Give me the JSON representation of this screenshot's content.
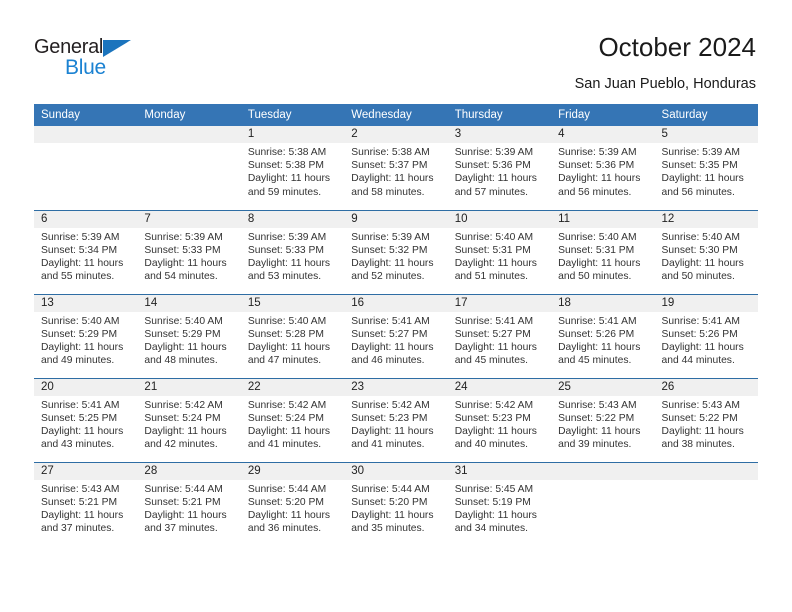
{
  "brand": {
    "name_dark": "General",
    "name_light": "Blue",
    "triangle_color": "#1b74bd",
    "blue_color": "#1b82d2"
  },
  "header": {
    "title": "October 2024",
    "location": "San Juan Pueblo, Honduras"
  },
  "theme": {
    "header_blue": "#3575b5",
    "separator_blue": "#2e6da4",
    "daynum_band": "#f0f0f0"
  },
  "weekdays": [
    "Sunday",
    "Monday",
    "Tuesday",
    "Wednesday",
    "Thursday",
    "Friday",
    "Saturday"
  ],
  "weeks": [
    [
      {
        "day": "",
        "empty": true
      },
      {
        "day": "",
        "empty": true
      },
      {
        "day": "1",
        "sunrise": "Sunrise: 5:38 AM",
        "sunset": "Sunset: 5:38 PM",
        "daylight1": "Daylight: 11 hours",
        "daylight2": "and 59 minutes."
      },
      {
        "day": "2",
        "sunrise": "Sunrise: 5:38 AM",
        "sunset": "Sunset: 5:37 PM",
        "daylight1": "Daylight: 11 hours",
        "daylight2": "and 58 minutes."
      },
      {
        "day": "3",
        "sunrise": "Sunrise: 5:39 AM",
        "sunset": "Sunset: 5:36 PM",
        "daylight1": "Daylight: 11 hours",
        "daylight2": "and 57 minutes."
      },
      {
        "day": "4",
        "sunrise": "Sunrise: 5:39 AM",
        "sunset": "Sunset: 5:36 PM",
        "daylight1": "Daylight: 11 hours",
        "daylight2": "and 56 minutes."
      },
      {
        "day": "5",
        "sunrise": "Sunrise: 5:39 AM",
        "sunset": "Sunset: 5:35 PM",
        "daylight1": "Daylight: 11 hours",
        "daylight2": "and 56 minutes."
      }
    ],
    [
      {
        "day": "6",
        "sunrise": "Sunrise: 5:39 AM",
        "sunset": "Sunset: 5:34 PM",
        "daylight1": "Daylight: 11 hours",
        "daylight2": "and 55 minutes."
      },
      {
        "day": "7",
        "sunrise": "Sunrise: 5:39 AM",
        "sunset": "Sunset: 5:33 PM",
        "daylight1": "Daylight: 11 hours",
        "daylight2": "and 54 minutes."
      },
      {
        "day": "8",
        "sunrise": "Sunrise: 5:39 AM",
        "sunset": "Sunset: 5:33 PM",
        "daylight1": "Daylight: 11 hours",
        "daylight2": "and 53 minutes."
      },
      {
        "day": "9",
        "sunrise": "Sunrise: 5:39 AM",
        "sunset": "Sunset: 5:32 PM",
        "daylight1": "Daylight: 11 hours",
        "daylight2": "and 52 minutes."
      },
      {
        "day": "10",
        "sunrise": "Sunrise: 5:40 AM",
        "sunset": "Sunset: 5:31 PM",
        "daylight1": "Daylight: 11 hours",
        "daylight2": "and 51 minutes."
      },
      {
        "day": "11",
        "sunrise": "Sunrise: 5:40 AM",
        "sunset": "Sunset: 5:31 PM",
        "daylight1": "Daylight: 11 hours",
        "daylight2": "and 50 minutes."
      },
      {
        "day": "12",
        "sunrise": "Sunrise: 5:40 AM",
        "sunset": "Sunset: 5:30 PM",
        "daylight1": "Daylight: 11 hours",
        "daylight2": "and 50 minutes."
      }
    ],
    [
      {
        "day": "13",
        "sunrise": "Sunrise: 5:40 AM",
        "sunset": "Sunset: 5:29 PM",
        "daylight1": "Daylight: 11 hours",
        "daylight2": "and 49 minutes."
      },
      {
        "day": "14",
        "sunrise": "Sunrise: 5:40 AM",
        "sunset": "Sunset: 5:29 PM",
        "daylight1": "Daylight: 11 hours",
        "daylight2": "and 48 minutes."
      },
      {
        "day": "15",
        "sunrise": "Sunrise: 5:40 AM",
        "sunset": "Sunset: 5:28 PM",
        "daylight1": "Daylight: 11 hours",
        "daylight2": "and 47 minutes."
      },
      {
        "day": "16",
        "sunrise": "Sunrise: 5:41 AM",
        "sunset": "Sunset: 5:27 PM",
        "daylight1": "Daylight: 11 hours",
        "daylight2": "and 46 minutes."
      },
      {
        "day": "17",
        "sunrise": "Sunrise: 5:41 AM",
        "sunset": "Sunset: 5:27 PM",
        "daylight1": "Daylight: 11 hours",
        "daylight2": "and 45 minutes."
      },
      {
        "day": "18",
        "sunrise": "Sunrise: 5:41 AM",
        "sunset": "Sunset: 5:26 PM",
        "daylight1": "Daylight: 11 hours",
        "daylight2": "and 45 minutes."
      },
      {
        "day": "19",
        "sunrise": "Sunrise: 5:41 AM",
        "sunset": "Sunset: 5:26 PM",
        "daylight1": "Daylight: 11 hours",
        "daylight2": "and 44 minutes."
      }
    ],
    [
      {
        "day": "20",
        "sunrise": "Sunrise: 5:41 AM",
        "sunset": "Sunset: 5:25 PM",
        "daylight1": "Daylight: 11 hours",
        "daylight2": "and 43 minutes."
      },
      {
        "day": "21",
        "sunrise": "Sunrise: 5:42 AM",
        "sunset": "Sunset: 5:24 PM",
        "daylight1": "Daylight: 11 hours",
        "daylight2": "and 42 minutes."
      },
      {
        "day": "22",
        "sunrise": "Sunrise: 5:42 AM",
        "sunset": "Sunset: 5:24 PM",
        "daylight1": "Daylight: 11 hours",
        "daylight2": "and 41 minutes."
      },
      {
        "day": "23",
        "sunrise": "Sunrise: 5:42 AM",
        "sunset": "Sunset: 5:23 PM",
        "daylight1": "Daylight: 11 hours",
        "daylight2": "and 41 minutes."
      },
      {
        "day": "24",
        "sunrise": "Sunrise: 5:42 AM",
        "sunset": "Sunset: 5:23 PM",
        "daylight1": "Daylight: 11 hours",
        "daylight2": "and 40 minutes."
      },
      {
        "day": "25",
        "sunrise": "Sunrise: 5:43 AM",
        "sunset": "Sunset: 5:22 PM",
        "daylight1": "Daylight: 11 hours",
        "daylight2": "and 39 minutes."
      },
      {
        "day": "26",
        "sunrise": "Sunrise: 5:43 AM",
        "sunset": "Sunset: 5:22 PM",
        "daylight1": "Daylight: 11 hours",
        "daylight2": "and 38 minutes."
      }
    ],
    [
      {
        "day": "27",
        "sunrise": "Sunrise: 5:43 AM",
        "sunset": "Sunset: 5:21 PM",
        "daylight1": "Daylight: 11 hours",
        "daylight2": "and 37 minutes."
      },
      {
        "day": "28",
        "sunrise": "Sunrise: 5:44 AM",
        "sunset": "Sunset: 5:21 PM",
        "daylight1": "Daylight: 11 hours",
        "daylight2": "and 37 minutes."
      },
      {
        "day": "29",
        "sunrise": "Sunrise: 5:44 AM",
        "sunset": "Sunset: 5:20 PM",
        "daylight1": "Daylight: 11 hours",
        "daylight2": "and 36 minutes."
      },
      {
        "day": "30",
        "sunrise": "Sunrise: 5:44 AM",
        "sunset": "Sunset: 5:20 PM",
        "daylight1": "Daylight: 11 hours",
        "daylight2": "and 35 minutes."
      },
      {
        "day": "31",
        "sunrise": "Sunrise: 5:45 AM",
        "sunset": "Sunset: 5:19 PM",
        "daylight1": "Daylight: 11 hours",
        "daylight2": "and 34 minutes."
      },
      {
        "day": "",
        "empty": true
      },
      {
        "day": "",
        "empty": true
      }
    ]
  ]
}
